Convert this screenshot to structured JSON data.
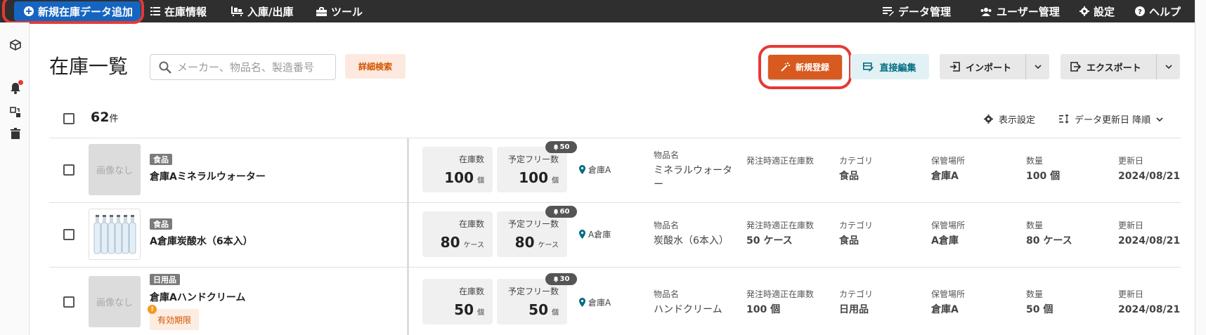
{
  "topnav": {
    "add_button": "新規在庫データ追加",
    "inventory": "在庫情報",
    "inout": "入庫/出庫",
    "tools": "ツール",
    "data_mgmt": "データ管理",
    "user_mgmt": "ユーザー管理",
    "settings": "設定",
    "help": "ヘルプ"
  },
  "page": {
    "title": "在庫一覧",
    "search_placeholder": "メーカー、物品名、製造番号",
    "advanced_search": "詳細検索",
    "new_register": "新規登録",
    "direct_edit": "直接編集",
    "import": "インポート",
    "export": "エクスポート"
  },
  "list": {
    "count": "62",
    "count_unit": "件",
    "display_settings": "表示設定",
    "sort_label": "データ更新日 降順"
  },
  "field_labels": {
    "stock": "在庫数",
    "free": "予定フリー数",
    "item_name": "物品名",
    "reorder": "発注時適正在庫数",
    "category": "カテゴリ",
    "place": "保管場所",
    "quantity": "数量",
    "updated": "更新日"
  },
  "rows": [
    {
      "thumb": "画像なし",
      "category": "食品",
      "name": "倉庫Aミネラルウォーター",
      "stock": "100",
      "stock_unit": "個",
      "free": "100",
      "free_unit": "個",
      "alert": "50",
      "location": "倉庫A",
      "item_name": "ミネラルウォーター",
      "reorder": "",
      "category_value": "食品",
      "place": "倉庫A",
      "quantity": "100 個",
      "updated": "2024/08/21"
    },
    {
      "thumb": "",
      "category": "食品",
      "name": "A倉庫炭酸水（6本入）",
      "stock": "80",
      "stock_unit": "ケース",
      "free": "80",
      "free_unit": "ケース",
      "alert": "60",
      "location": "A倉庫",
      "item_name": "炭酸水（6本入）",
      "reorder": "50 ケース",
      "category_value": "食品",
      "place": "A倉庫",
      "quantity": "80 ケース",
      "updated": "2024/08/21"
    },
    {
      "thumb": "画像なし",
      "category": "日用品",
      "name": "倉庫Aハンドクリーム",
      "expiry": "有効期限",
      "stock": "50",
      "stock_unit": "個",
      "free": "50",
      "free_unit": "個",
      "alert": "30",
      "location": "倉庫A",
      "item_name": "ハンドクリーム",
      "reorder": "100 個",
      "category_value": "日用品",
      "place": "倉庫A",
      "quantity": "50 個",
      "updated": "2024/08/21"
    }
  ],
  "colors": {
    "topbar": "#2f2f2f",
    "primary_blue": "#1565c0",
    "accent_orange": "#d85a1e",
    "highlight_red": "#e53935"
  },
  "icons": [
    "plus-circle-icon",
    "list-icon",
    "pallet-icon",
    "toolbox-icon",
    "data-icon",
    "users-icon",
    "gear-icon",
    "question-icon",
    "box-icon",
    "bell-icon",
    "transfer-icon",
    "trash-icon",
    "search-icon",
    "magic-wand-icon",
    "edit-table-icon",
    "import-icon",
    "export-icon",
    "chevron-down-icon",
    "sort-icon",
    "location-pin-icon"
  ]
}
